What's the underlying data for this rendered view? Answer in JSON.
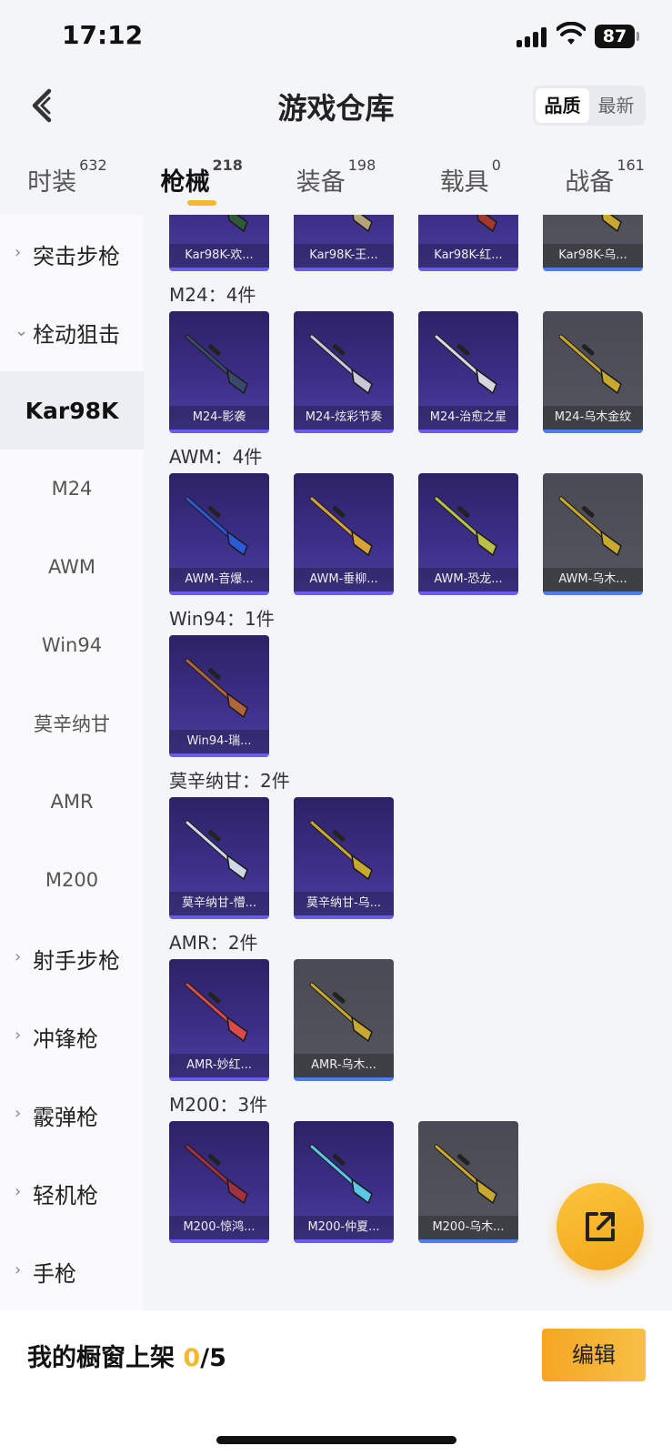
{
  "status_bar": {
    "time": "17:12",
    "battery": "87"
  },
  "header": {
    "title": "游戏仓库",
    "sort_quality": "品质",
    "sort_newest": "最新"
  },
  "tabs": [
    {
      "label": "时装",
      "count": "632"
    },
    {
      "label": "枪械",
      "count": "218"
    },
    {
      "label": "装备",
      "count": "198"
    },
    {
      "label": "载具",
      "count": "0"
    },
    {
      "label": "战备",
      "count": "161"
    }
  ],
  "sidebar": {
    "items": [
      {
        "label": "突击步枪"
      },
      {
        "label": "栓动狙击"
      },
      {
        "label": "Kar98K"
      },
      {
        "label": "M24"
      },
      {
        "label": "AWM"
      },
      {
        "label": "Win94"
      },
      {
        "label": "莫辛纳甘"
      },
      {
        "label": "AMR"
      },
      {
        "label": "M200"
      },
      {
        "label": "射手步枪"
      },
      {
        "label": "冲锋枪"
      },
      {
        "label": "霰弹枪"
      },
      {
        "label": "轻机枪"
      },
      {
        "label": "手枪"
      }
    ]
  },
  "sections": {
    "kar98k": {
      "items": [
        "Kar98K-欢...",
        "Kar98K-王...",
        "Kar98K-红...",
        "Kar98K-乌..."
      ]
    },
    "m24": {
      "title": "M24：4件",
      "items": [
        "M24-影袭",
        "M24-炫彩节奏",
        "M24-治愈之星",
        "M24-乌木金纹"
      ]
    },
    "awm": {
      "title": "AWM：4件",
      "items": [
        "AWM-音爆...",
        "AWM-垂柳...",
        "AWM-恐龙...",
        "AWM-乌木..."
      ]
    },
    "win94": {
      "title": "Win94：1件",
      "items": [
        "Win94-瑞..."
      ]
    },
    "mosin": {
      "title": "莫辛纳甘：2件",
      "items": [
        "莫辛纳甘-懵...",
        "莫辛纳甘-乌..."
      ]
    },
    "amr": {
      "title": "AMR：2件",
      "items": [
        "AMR-妙红...",
        "AMR-乌木..."
      ]
    },
    "m200": {
      "title": "M200：3件",
      "items": [
        "M200-惊鸿...",
        "M200-仲夏...",
        "M200-乌木..."
      ]
    }
  },
  "bottom_bar": {
    "label": "我的橱窗上架",
    "current": "0",
    "total": "/5",
    "edit": "编辑"
  },
  "colors": {
    "accent": "#f5b82e",
    "card_purple": "#3c2e86",
    "card_grey": "#55555f"
  },
  "icons": {
    "back": "chevron-left-icon",
    "fab": "share-external-icon",
    "collapsed": "chevron-right-icon",
    "expanded": "chevron-down-icon"
  }
}
